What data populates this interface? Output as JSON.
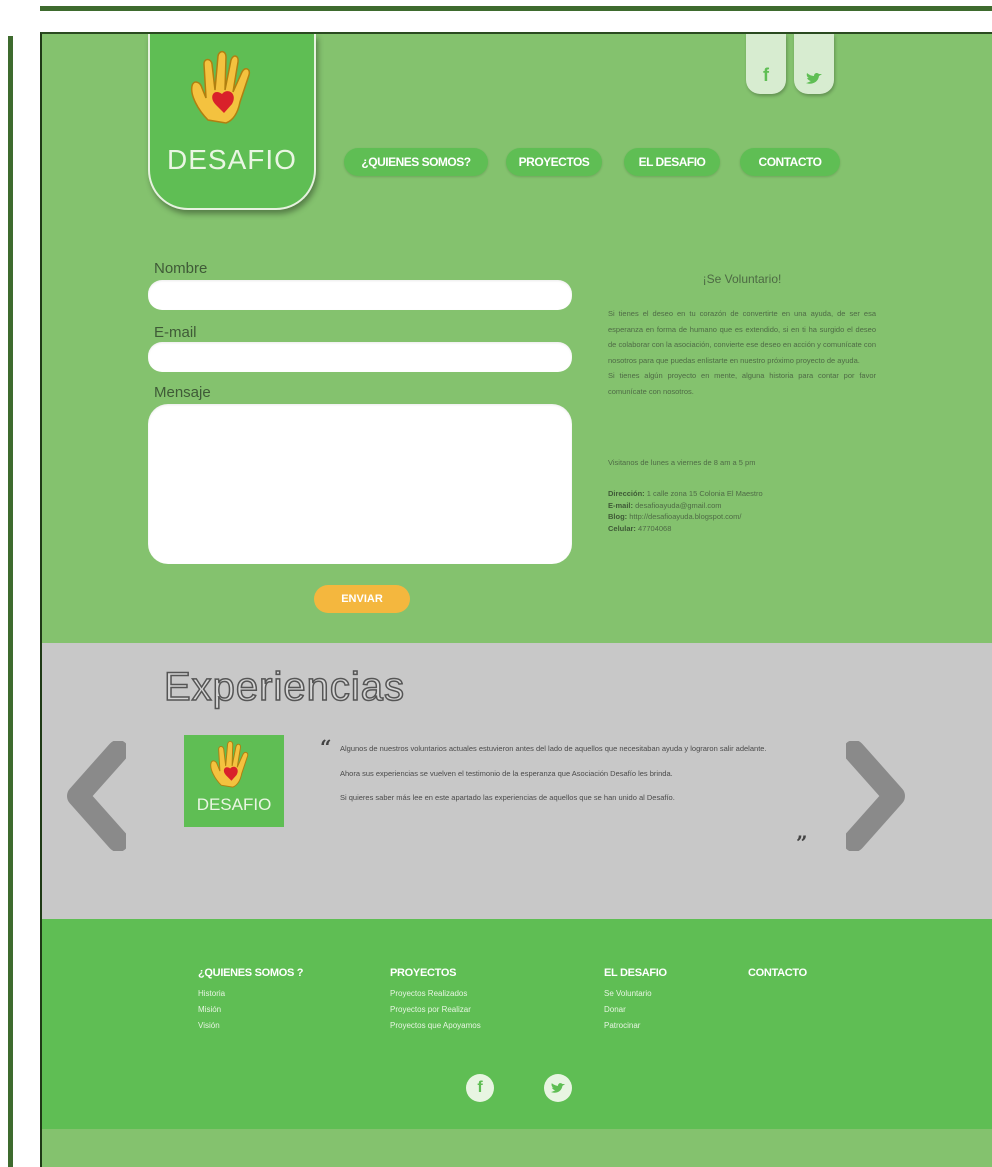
{
  "brand": {
    "name": "DESAFIO",
    "tagline": ""
  },
  "social": {
    "facebook": "f",
    "twitter": "t"
  },
  "nav": [
    "¿QUIENES SOMOS?",
    "PROYECTOS",
    "EL DESAFIO",
    "CONTACTO"
  ],
  "form": {
    "name_label": "Nombre",
    "email_label": "E-mail",
    "message_label": "Mensaje",
    "name_value": "",
    "email_value": "",
    "message_value": "",
    "submit_label": "ENVIAR"
  },
  "volunteer": {
    "title": "¡Se Voluntario!",
    "paragraph1": "Si tienes el deseo en tu corazón de convertirte en una ayuda, de ser esa esperanza en forma de humano que es extendido, si en ti ha surgido el deseo de colaborar con la asociación, convierte ese deseo en acción y comunícate con nosotros para que puedas enlistarte en nuestro próximo proyecto de ayuda.",
    "paragraph2": "Si tienes algún proyecto en mente, alguna historia para contar por favor comunícate con nosotros.",
    "hours": "Visitanos de lunes a viernes de 8 am a 5 pm",
    "address_label": "Dirección:",
    "address_value": "1 calle zona 15 Colonia El Maestro",
    "email_label": "E-mail:",
    "email_value": "desafioayuda@gmail.com",
    "blog_label": "Blog:",
    "blog_value": "http://desafioayuda.blogspot.com/",
    "phone_label": "Celular:",
    "phone_value": "47704068"
  },
  "experiences": {
    "title": "Experiencias",
    "logo_text": "DESAFIO",
    "quote_open": "“",
    "quote_close": "”",
    "p1": "Algunos de nuestros voluntarios actuales estuvieron antes del lado de aquellos que necesitaban ayuda y lograron salir adelante.",
    "p2": "Ahora sus experiencias se vuelven el testimonio de la esperanza que Asociación Desafío les brinda.",
    "p3": "Si quieres saber más lee en este apartado las experiencias de aquellos que se han unido al Desafío."
  },
  "footer": {
    "columns": [
      {
        "heading": "¿QUIENES SOMOS ?",
        "items": [
          "Historia",
          "Misión",
          "Visión"
        ]
      },
      {
        "heading": "PROYECTOS",
        "items": [
          "Proyectos Realizados",
          "Proyectos por Realizar",
          "Proyectos que Apoyamos"
        ]
      },
      {
        "heading": "EL DESAFIO",
        "items": [
          "Se Voluntario",
          "Donar",
          "Patrocinar"
        ]
      },
      {
        "heading": "CONTACTO",
        "items": []
      }
    ],
    "facebook": "f",
    "twitter": "t"
  },
  "colors": {
    "hero": "#84c26e",
    "brand_green": "#5fbe54",
    "frame": "#3e6b2e",
    "accent": "#f4b73e",
    "gray": "#c8c8c8"
  }
}
